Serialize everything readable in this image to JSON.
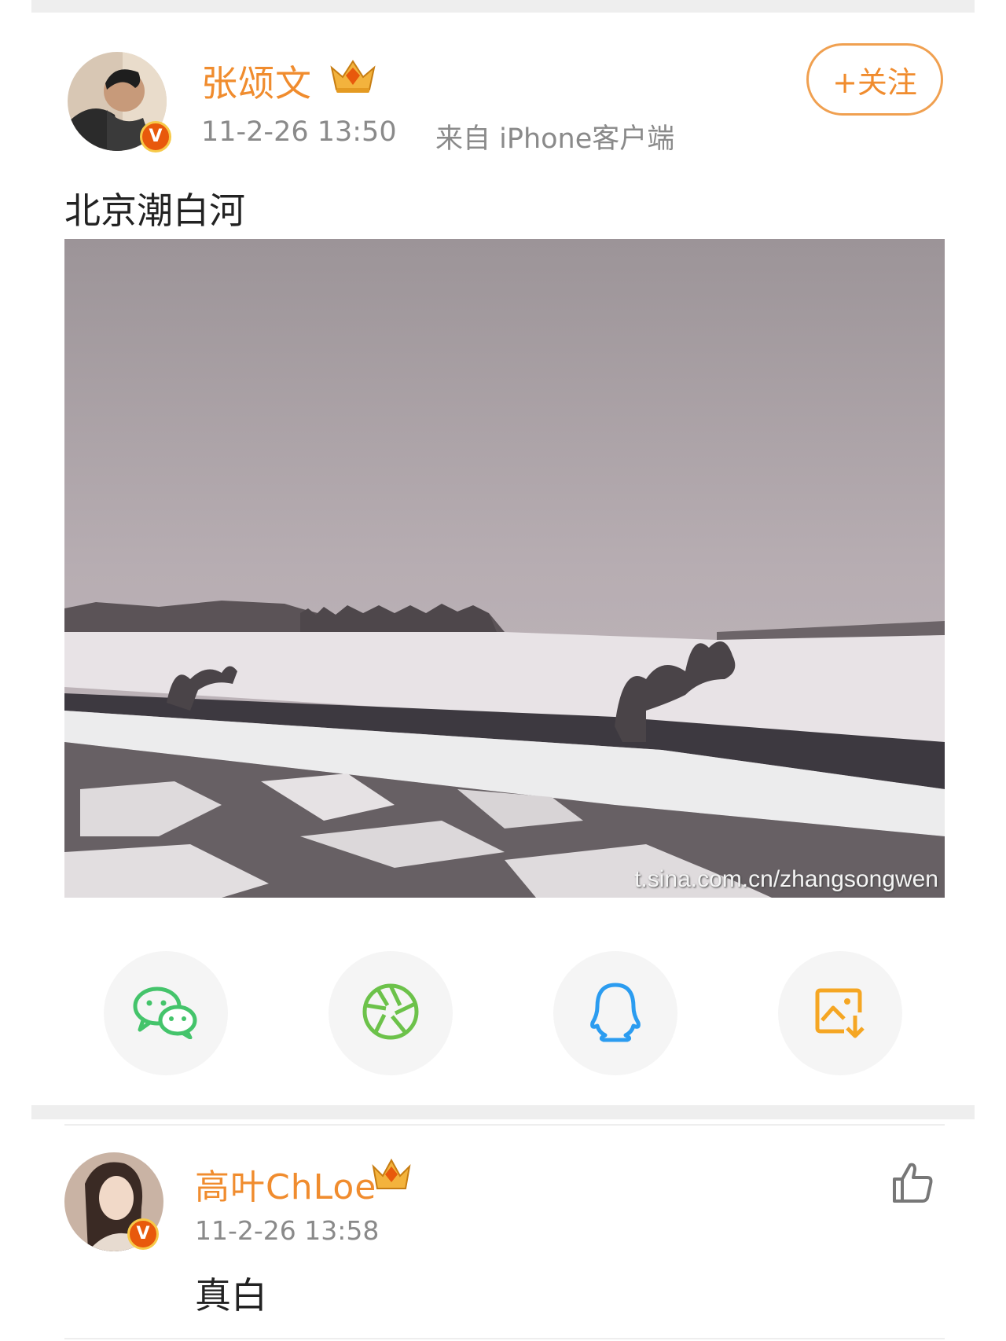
{
  "post": {
    "username": "张颂文",
    "timestamp": "11-2-26 13:50",
    "source": "来自 iPhone客户端",
    "follow_label": "+关注",
    "text": "北京潮白河",
    "photo_watermark": "t.sina.com.cn/zhangsongwen",
    "badge_letter": "V"
  },
  "share_actions": [
    {
      "name": "wechat-icon",
      "color": "#44c46b"
    },
    {
      "name": "moments-icon",
      "color": "#6cc24a"
    },
    {
      "name": "qq-icon",
      "color": "#2b9cf0"
    },
    {
      "name": "save-image-icon",
      "color": "#f5a623"
    }
  ],
  "comment": {
    "username": "高叶ChLoe",
    "timestamp": "11-2-26 13:58",
    "text": "真白",
    "badge_letter": "V"
  },
  "colors": {
    "accent": "#f08c2e",
    "verified_badge": "#e8590c"
  }
}
